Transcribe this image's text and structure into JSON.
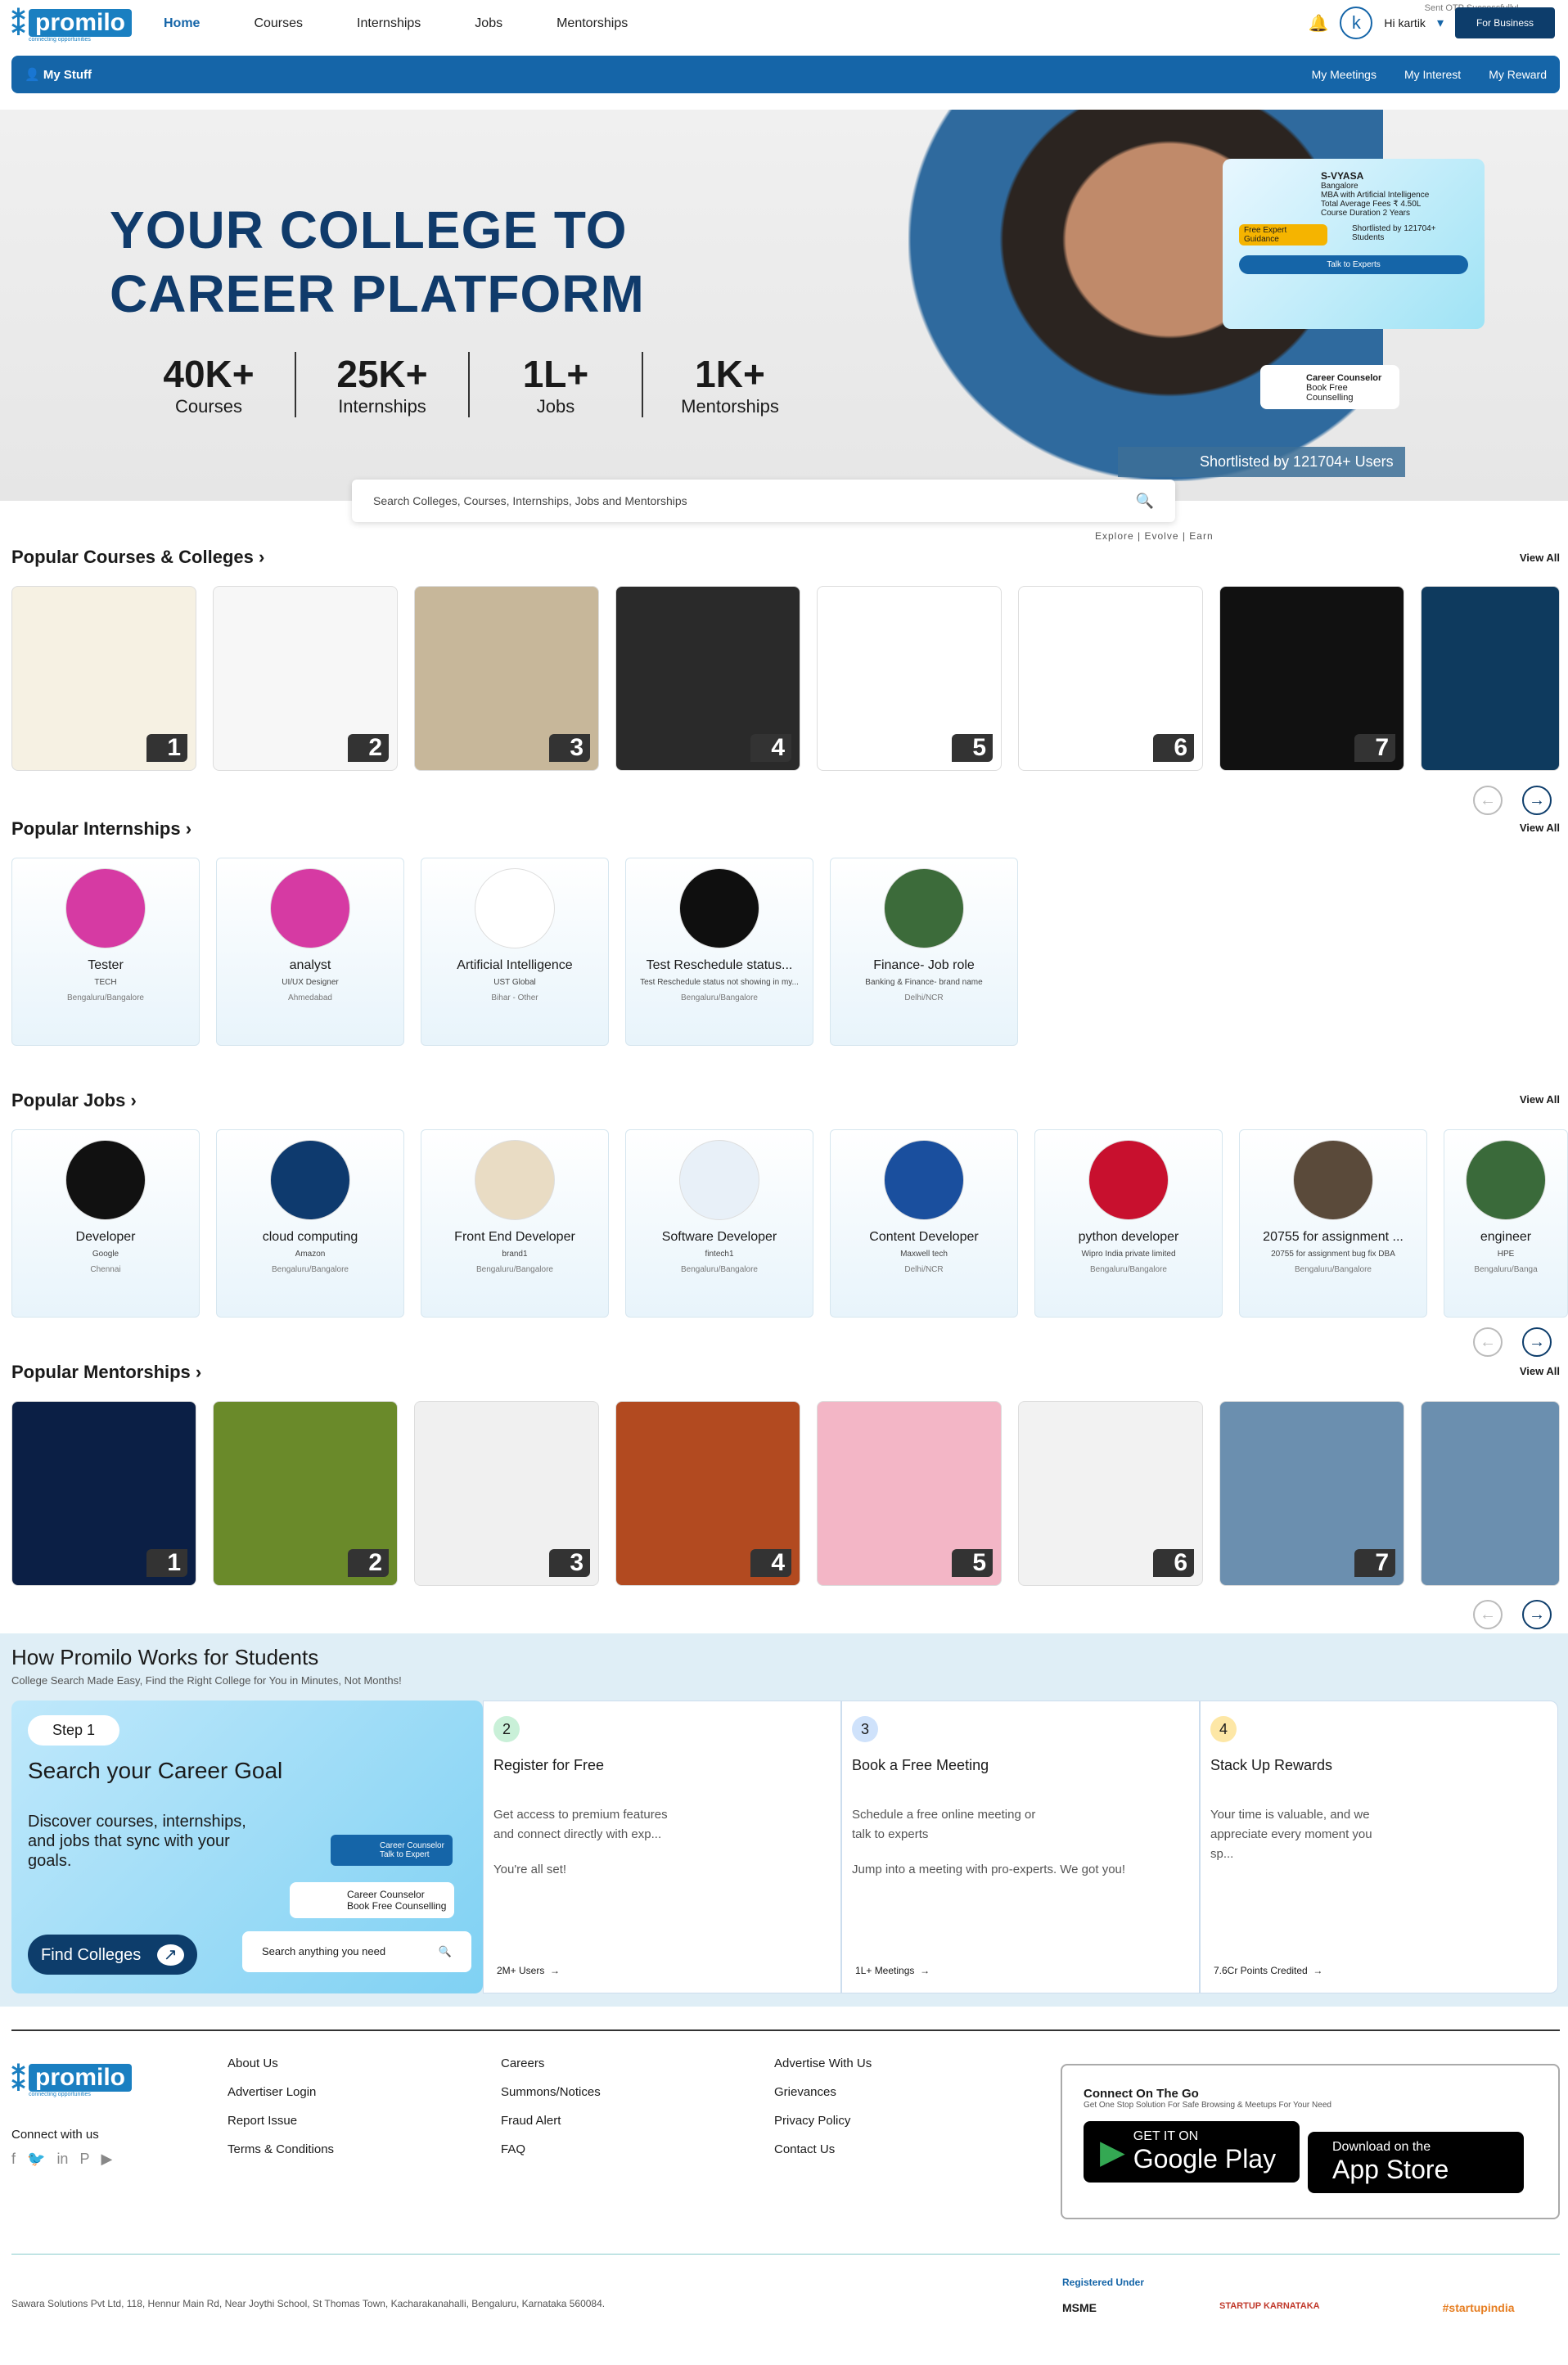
{
  "nav": {
    "logo_word": "promilo",
    "logo_tagline": "connecting opportunities",
    "links": [
      "Home",
      "Courses",
      "Internships",
      "Jobs",
      "Mentorships"
    ],
    "greeting": "Hi kartik",
    "avatar_letter": "k",
    "business_label": "For Business",
    "toast": "Sent OTP Successfully!"
  },
  "mystuff": {
    "label": "My Stuff",
    "links": [
      "My Meetings",
      "My Interest",
      "My Reward"
    ]
  },
  "hero": {
    "title": "YOUR COLLEGE TO CAREER PLATFORM",
    "stats": [
      {
        "n": "40K+",
        "l": "Courses"
      },
      {
        "n": "25K+",
        "l": "Internships"
      },
      {
        "n": "1L+",
        "l": "Jobs"
      },
      {
        "n": "1K+",
        "l": "Mentorships"
      }
    ],
    "card_name": "S-VYASA",
    "card_city": "Bangalore",
    "card_course": "MBA with Artificial Intelligence",
    "card_fees": "Total Average Fees  ₹ 4.50L",
    "card_duration": "Course Duration  2 Years",
    "card_guidance": "Free Expert Guidance",
    "card_shortlisted": "Shortlisted by 121704+ Students",
    "card_talk": "Talk to Experts",
    "cc_title": "Career Counselor",
    "cc_sub": "Book Free Counselling",
    "shortlisted": "Shortlisted by 121704+ Users"
  },
  "search": {
    "placeholder": "Search Colleges, Courses, Internships, Jobs and Mentorships"
  },
  "tagline": "Explore | Evolve | Earn",
  "sections": {
    "courses": "Popular Courses & Colleges",
    "internships": "Popular Internships",
    "jobs": "Popular Jobs",
    "mentorships": "Popular Mentorships",
    "view_all": "View All"
  },
  "course_tiles": [
    "1",
    "2",
    "3",
    "4",
    "5",
    "6",
    "7",
    ""
  ],
  "course_tile_colors": [
    "#f6f1e3",
    "#f7f7f7",
    "#c7b79a",
    "#2a2a2a",
    "#ffffff",
    "#ffffff",
    "#111111",
    "#0e3a5e"
  ],
  "internships": [
    {
      "t": "Tester",
      "s": "TECH",
      "loc": "Bengaluru/Bangalore",
      "color": "#d63aa3"
    },
    {
      "t": "analyst",
      "s": "UI/UX Designer",
      "loc": "Ahmedabad",
      "color": "#d63aa3"
    },
    {
      "t": "Artificial Intelligence",
      "s": "UST Global",
      "loc": "Bihar - Other",
      "color": "#ffffff"
    },
    {
      "t": "Test Reschedule status...",
      "s": "Test Reschedule status not showing in my...",
      "loc": "Bengaluru/Bangalore",
      "color": "#0f0f0f"
    },
    {
      "t": "Finance- Job role",
      "s": "Banking & Finance- brand name",
      "loc": "Delhi/NCR",
      "color": "#3c6b3a"
    }
  ],
  "jobs": [
    {
      "t": "Developer",
      "s": "Google",
      "loc": "Chennai",
      "color": "#111111"
    },
    {
      "t": "cloud computing",
      "s": "Amazon",
      "loc": "Bengaluru/Bangalore",
      "color": "#0e3a6e"
    },
    {
      "t": "Front End Developer",
      "s": "brand1",
      "loc": "Bengaluru/Bangalore",
      "color": "#e9dcc4"
    },
    {
      "t": "Software Developer",
      "s": "fintech1",
      "loc": "Bengaluru/Bangalore",
      "color": "#e8f0f8"
    },
    {
      "t": "Content Developer",
      "s": "Maxwell tech",
      "loc": "Delhi/NCR",
      "color": "#1a4f9e"
    },
    {
      "t": "python developer",
      "s": "Wipro India private limited",
      "loc": "Bengaluru/Bangalore",
      "color": "#c8102e"
    },
    {
      "t": "20755 for assignment ...",
      "s": "20755 for assignment bug fix DBA",
      "loc": "Bengaluru/Bangalore",
      "color": "#5a4a3a"
    },
    {
      "t": "engineer",
      "s": "HPE",
      "loc": "Bengaluru/Banga",
      "color": "#3a6a3a"
    }
  ],
  "mentor_tiles": [
    "1",
    "2",
    "3",
    "4",
    "5",
    "6",
    "7",
    ""
  ],
  "mentor_tile_colors": [
    "#0b1f45",
    "#6a8a2a",
    "#f0f0f0",
    "#b24a20",
    "#f3b6c6",
    "#f2f2f2",
    "#6b8faf",
    "#6b8faf"
  ],
  "how": {
    "title": "How Promilo Works for Students",
    "sub": "College Search Made Easy, Find the Right College for You in Minutes, Not Months!",
    "step_badge": "Step 1",
    "step_title": "Search your Career Goal",
    "step_desc": "Discover courses, internships, and jobs that sync with your goals.",
    "find_colleges": "Find Colleges",
    "search_placeholder": "Search anything you need",
    "cc1": "Career Counselor",
    "cc1_sub": "Talk to Expert",
    "cc2": "Career Counselor",
    "cc2_sub": "Book Free Counselling",
    "cards": [
      {
        "n": "2",
        "h": "Register for Free",
        "p": "Get access to premium features and connect directly with exp...",
        "p2": "You're all set!",
        "foot": "2M+ Users",
        "color": "#c9f0d8"
      },
      {
        "n": "3",
        "h": "Book a Free Meeting",
        "p": "Schedule a free online meeting or talk to experts",
        "p2": "Jump into a meeting with pro-experts. We got you!",
        "foot": "1L+ Meetings",
        "color": "#cfe2fb"
      },
      {
        "n": "4",
        "h": "Stack Up Rewards",
        "p": "Your time is valuable, and we appreciate every moment you sp...",
        "p2": "",
        "foot": "7.6Cr Points Credited",
        "color": "#fde7a6"
      }
    ]
  },
  "footer": {
    "connect": "Connect with us",
    "col1": [
      "About Us",
      "Advertiser Login",
      "Report Issue",
      "Terms & Conditions"
    ],
    "col2": [
      "Careers",
      "Summons/Notices",
      "Fraud Alert",
      "FAQ"
    ],
    "col3": [
      "Advertise With Us",
      "Grievances",
      "Privacy Policy",
      "Contact Us"
    ],
    "apps_title": "Connect On The Go",
    "apps_sub": "Get One Stop Solution For Safe Browsing & Meetups For Your Need",
    "gp_small": "GET IT ON",
    "gp_big": "Google Play",
    "as_small": "Download on the",
    "as_big": "App Store",
    "address": "Sawara Solutions Pvt Ltd, 118, Hennur Main Rd, Near Joythi School, St Thomas Town, Kacharakanahalli, Bengaluru, Karnataka 560084.",
    "registered": "Registered Under",
    "regs": [
      "MSME",
      "STARTUP KARNATAKA",
      "#startupindia"
    ]
  }
}
